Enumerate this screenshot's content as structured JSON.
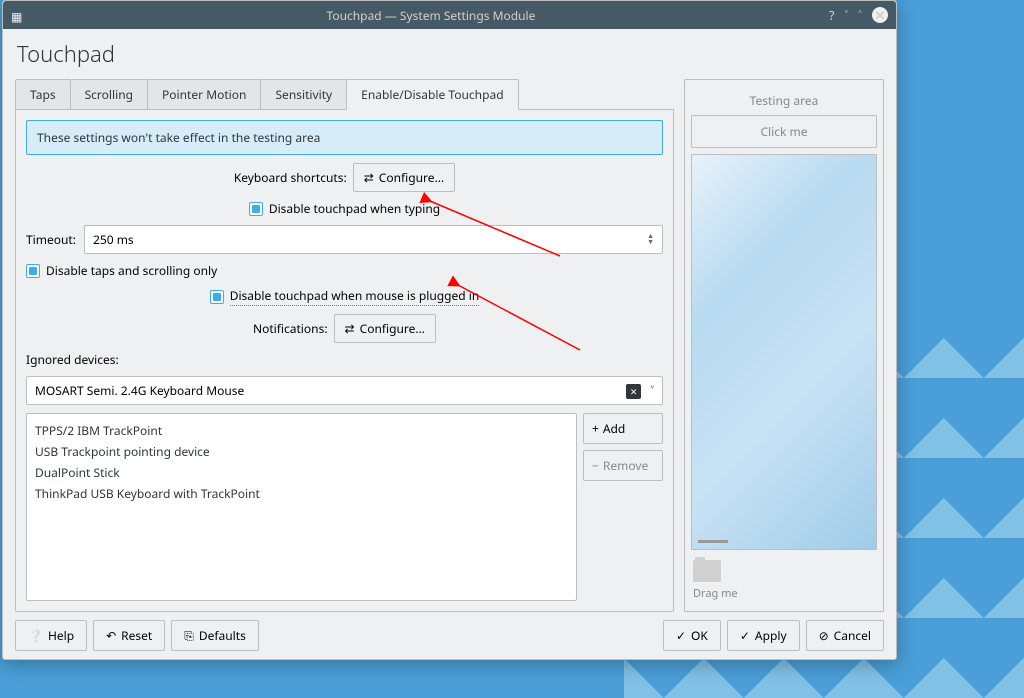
{
  "window": {
    "title": "Touchpad — System Settings Module"
  },
  "page": {
    "title": "Touchpad"
  },
  "tabs": [
    "Taps",
    "Scrolling",
    "Pointer Motion",
    "Sensitivity",
    "Enable/Disable Touchpad"
  ],
  "active_tab": 4,
  "banner": "These settings won't take effect in the testing area",
  "labels": {
    "keyboard_shortcuts": "Keyboard shortcuts:",
    "configure": "Configure...",
    "disable_typing": "Disable touchpad when typing",
    "timeout": "Timeout:",
    "timeout_value": "250 ms",
    "disable_taps_scroll": "Disable taps and scrolling only",
    "disable_mouse": "Disable touchpad when mouse is plugged in",
    "notifications": "Notifications:",
    "ignored_devices": "Ignored devices:",
    "selected_device": "MOSART Semi. 2.4G Keyboard Mouse",
    "add": "Add",
    "remove": "Remove"
  },
  "devices": [
    "TPPS/2 IBM TrackPoint",
    "USB Trackpoint pointing device",
    "DualPoint Stick",
    "ThinkPad USB Keyboard with TrackPoint"
  ],
  "testing": {
    "title": "Testing area",
    "click_me": "Click me",
    "drag_me": "Drag me"
  },
  "buttons": {
    "help": "Help",
    "reset": "Reset",
    "defaults": "Defaults",
    "ok": "OK",
    "apply": "Apply",
    "cancel": "Cancel"
  }
}
